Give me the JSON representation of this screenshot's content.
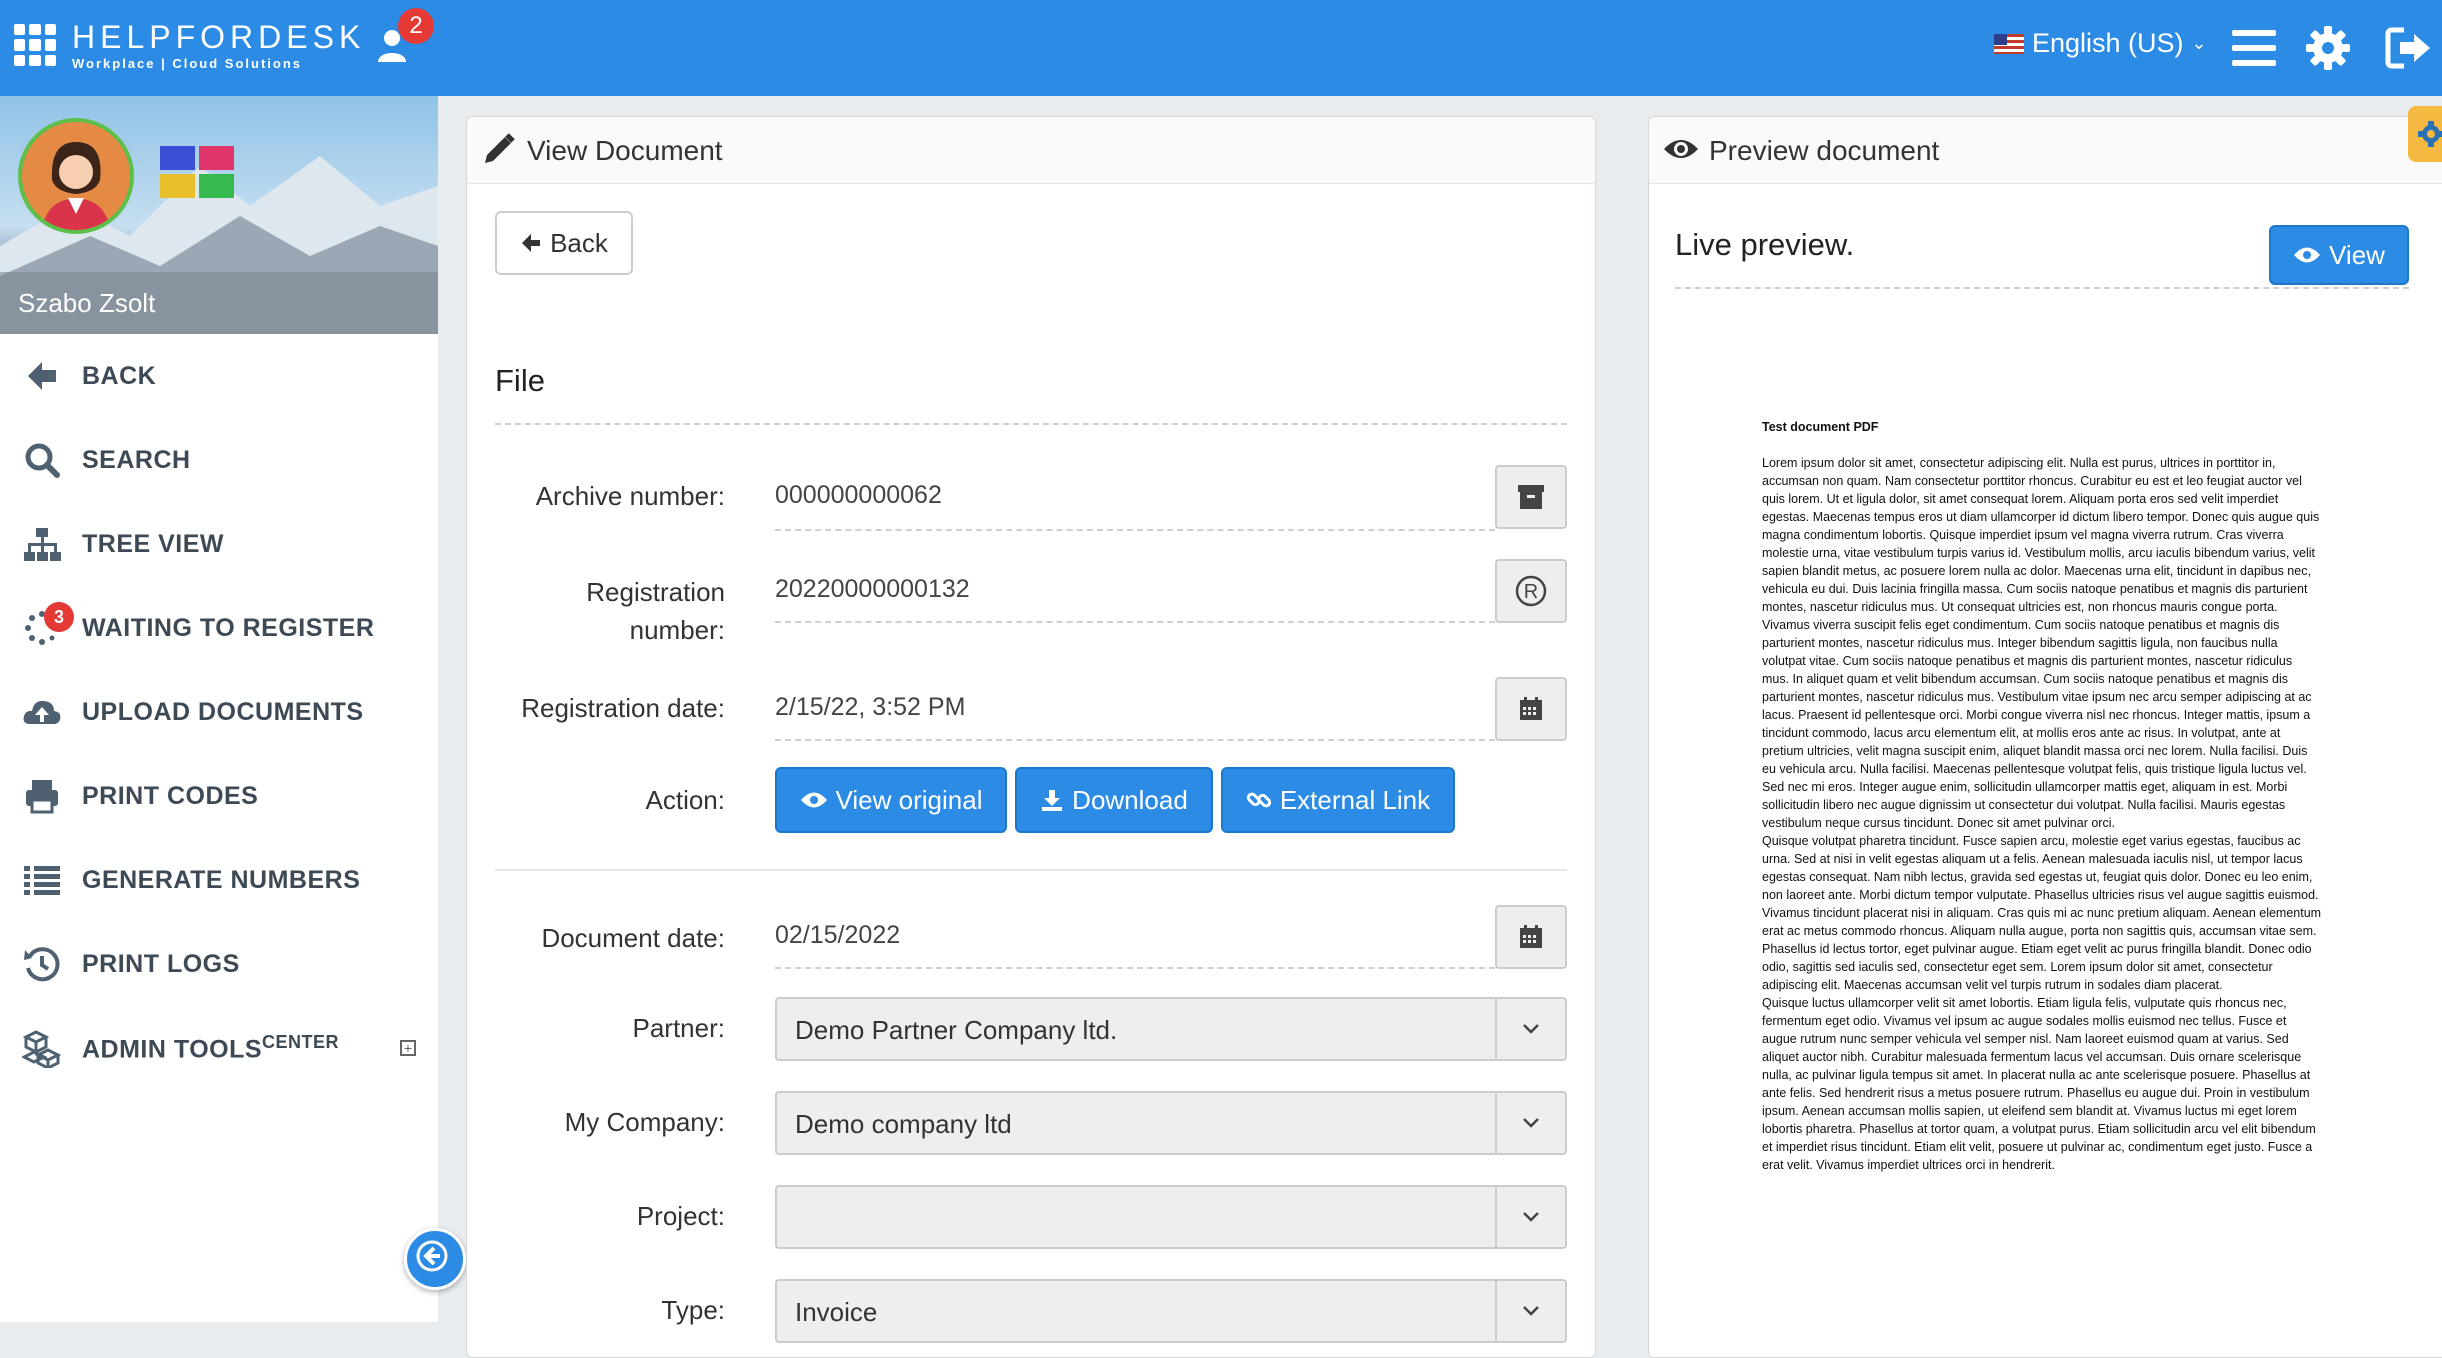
{
  "header": {
    "brand_name": "HELPFORDESK",
    "brand_sub": "Workplace | Cloud Solutions",
    "notification_count": "2",
    "language": "English (US)",
    "icons": [
      "user-notification-icon",
      "menu-icon",
      "gear-icon",
      "logout-icon"
    ]
  },
  "sidebar": {
    "username": "Szabo Zsolt",
    "items": [
      {
        "label": "BACK",
        "icon": "arrow-left-icon"
      },
      {
        "label": "SEARCH",
        "icon": "search-icon"
      },
      {
        "label": "TREE VIEW",
        "icon": "sitemap-icon"
      },
      {
        "label": "WAITING TO REGISTER",
        "icon": "spinner-icon",
        "badge": "3"
      },
      {
        "label": "UPLOAD DOCUMENTS",
        "icon": "cloud-upload-icon"
      },
      {
        "label": "PRINT CODES",
        "icon": "printer-icon"
      },
      {
        "label": "GENERATE NUMBERS",
        "icon": "list-icon"
      },
      {
        "label": "PRINT LOGS",
        "icon": "history-icon"
      },
      {
        "label": "ADMIN TOOLS",
        "label_sup": "CENTER",
        "icon": "cubes-icon"
      }
    ]
  },
  "view_panel": {
    "title": "View Document",
    "back_label": "Back",
    "section_title": "File",
    "fields": {
      "archive_label": "Archive number:",
      "archive_value": "000000000062",
      "registration_label_1": "Registration",
      "registration_label_2": "number:",
      "registration_value": "20220000000132",
      "reg_date_label": "Registration date:",
      "reg_date_value": "2/15/22, 3:52 PM",
      "action_label": "Action:",
      "doc_date_label": "Document date:",
      "doc_date_value": "02/15/2022",
      "partner_label": "Partner:",
      "partner_value": "Demo Partner Company ltd.",
      "company_label": "My Company:",
      "company_value": "Demo company ltd",
      "project_label": "Project:",
      "project_value": "",
      "type_label": "Type:",
      "type_value": "Invoice"
    },
    "actions": {
      "view_original": "View original",
      "download": "Download",
      "external_link": "External Link"
    }
  },
  "preview_panel": {
    "title": "Preview document",
    "live_preview": "Live preview.",
    "view_button": "View",
    "doc_title": "Test document PDF",
    "doc_paragraphs": [
      "Lorem ipsum dolor sit amet, consectetur adipiscing elit. Nulla est purus, ultrices in porttitor in, accumsan non quam. Nam consectetur porttitor rhoncus. Curabitur eu est et leo feugiat auctor vel quis lorem. Ut et ligula dolor, sit amet consequat lorem. Aliquam porta eros sed velit imperdiet egestas. Maecenas tempus eros ut diam ullamcorper id dictum libero tempor. Donec quis augue quis magna condimentum lobortis. Quisque imperdiet ipsum vel magna viverra rutrum. Cras viverra molestie urna, vitae vestibulum turpis varius id. Vestibulum mollis, arcu iaculis bibendum varius, velit sapien blandit metus, ac posuere lorem nulla ac dolor. Maecenas urna elit, tincidunt in dapibus nec, vehicula eu dui. Duis lacinia fringilla massa. Cum sociis natoque penatibus et magnis dis parturient montes, nascetur ridiculus mus. Ut consequat ultricies est, non rhoncus mauris congue porta. Vivamus viverra suscipit felis eget condimentum. Cum sociis natoque penatibus et magnis dis parturient montes, nascetur ridiculus mus. Integer bibendum sagittis ligula, non faucibus nulla volutpat vitae. Cum sociis natoque penatibus et magnis dis parturient montes, nascetur ridiculus mus. In aliquet quam et velit bibendum accumsan. Cum sociis natoque penatibus et magnis dis parturient montes, nascetur ridiculus mus. Vestibulum vitae ipsum nec arcu semper adipiscing at ac lacus. Praesent id pellentesque orci. Morbi congue viverra nisl nec rhoncus. Integer mattis, ipsum a tincidunt commodo, lacus arcu elementum elit, at mollis eros ante ac risus. In volutpat, ante at pretium ultricies, velit magna suscipit enim, aliquet blandit massa orci nec lorem. Nulla facilisi. Duis eu vehicula arcu. Nulla facilisi. Maecenas pellentesque volutpat felis, quis tristique ligula luctus vel. Sed nec mi eros. Integer augue enim, sollicitudin ullamcorper mattis eget, aliquam in est. Morbi sollicitudin libero nec augue dignissim ut consectetur dui volutpat. Nulla facilisi. Mauris egestas vestibulum neque cursus tincidunt. Donec sit amet pulvinar orci.",
      "Quisque volutpat pharetra tincidunt. Fusce sapien arcu, molestie eget varius egestas, faucibus ac urna. Sed at nisi in velit egestas aliquam ut a felis. Aenean malesuada iaculis nisl, ut tempor lacus egestas consequat. Nam nibh lectus, gravida sed egestas ut, feugiat quis dolor. Donec eu leo enim, non laoreet ante. Morbi dictum tempor vulputate. Phasellus ultricies risus vel augue sagittis euismod. Vivamus tincidunt placerat nisi in aliquam. Cras quis mi ac nunc pretium aliquam. Aenean elementum erat ac metus commodo rhoncus. Aliquam nulla augue, porta non sagittis quis, accumsan vitae sem. Phasellus id lectus tortor, eget pulvinar augue. Etiam eget velit ac purus fringilla blandit. Donec odio odio, sagittis sed iaculis sed, consectetur eget sem. Lorem ipsum dolor sit amet, consectetur adipiscing elit. Maecenas accumsan velit vel turpis rutrum in sodales diam placerat.",
      "Quisque luctus ullamcorper velit sit amet lobortis. Etiam ligula felis, vulputate quis rhoncus nec, fermentum eget odio. Vivamus vel ipsum ac augue sodales mollis euismod nec tellus. Fusce et augue rutrum nunc semper vehicula vel semper nisl. Nam laoreet euismod quam at varius. Sed aliquet auctor nibh. Curabitur malesuada fermentum lacus vel accumsan. Duis ornare scelerisque nulla, ac pulvinar ligula tempus sit amet. In placerat nulla ac ante scelerisque posuere. Phasellus at ante felis. Sed hendrerit risus a metus posuere rutrum. Phasellus eu augue dui. Proin in vestibulum ipsum. Aenean accumsan mollis sapien, ut eleifend sem blandit at. Vivamus luctus mi eget lorem lobortis pharetra. Phasellus at tortor quam, a volutpat purus. Etiam sollicitudin arcu vel elit bibendum et imperdiet risus tincidunt. Etiam elit velit, posuere ut pulvinar ac, condimentum eget justo. Fusce a erat velit. Vivamus imperdiet ultrices orci in hendrerit."
    ]
  },
  "colors": {
    "primary": "#2b8be5",
    "badge_red": "#e53935",
    "sidebar_text": "#3d4a55"
  }
}
